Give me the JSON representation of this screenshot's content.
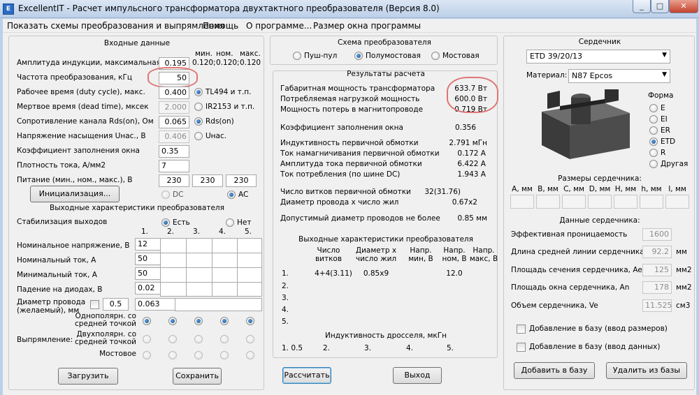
{
  "window": {
    "title": "ExcellentIT - Расчет импульсного трансформатора двухтактного преобразователя (Версия 8.0)",
    "icon": "app-icon"
  },
  "menu": [
    "Показать схемы преобразования и выпрямления",
    "Помощь",
    "О программе...",
    "Размер окна программы"
  ],
  "input": {
    "title": "Входные данные",
    "col_headers": [
      "мин.",
      "ном.",
      "макс."
    ],
    "amp_label": "Амплитуда индукции, максимальная, Т",
    "amp_value": "0.195",
    "amp_ref": [
      "0.120;",
      "0.120;",
      "0.120"
    ],
    "freq_label": "Частота преобразования, кГц",
    "freq_value": "50",
    "duty_label": "Рабочее время (duty cycle), макс.",
    "duty_value": "0.400",
    "duty_opt": "TL494 и т.п.",
    "dead_label": "Мертвое время (dead time), мксек",
    "dead_value": "2.000",
    "dead_opt": "IR2153 и т.п.",
    "rds_label": "Сопротивление канала Rds(on), Ом",
    "rds_value": "0.065",
    "rds_opt": "Rds(on)",
    "usat_label": "Напряжение насыщения Uнас., В",
    "usat_value": "0.406",
    "usat_opt": "Uнас.",
    "fill_label": "Коэффициент заполнения окна",
    "fill_value": "0.35",
    "dens_label": "Плотность тока, А/мм2",
    "dens_value": "7",
    "supply_label": "Питание (мин., ном., макс.), В",
    "supply": [
      "230",
      "230",
      "230"
    ],
    "init_button": "Инициализация...",
    "dc": "DC",
    "ac": "AC"
  },
  "output": {
    "title": "Выходные характеристики преобразователя",
    "stab_label": "Стабилизация выходов",
    "stab_yes": "Есть",
    "stab_no": "Нет",
    "cols": [
      "1.",
      "2.",
      "3.",
      "4.",
      "5."
    ],
    "rows": [
      {
        "label": "Номинальное напряжение, В",
        "value": "12"
      },
      {
        "label": "Номинальный ток, А",
        "value": "50"
      },
      {
        "label": "Минимальный ток, А",
        "value": "50"
      },
      {
        "label": "Падение на диодах, В",
        "value": "0.02"
      }
    ],
    "wire_label": "Диаметр провода\n(желаемый), мм",
    "wire_chk_value": "0.5",
    "wire_value": "0.063",
    "rect_label": "Выпрямление:",
    "rect_opts": [
      "Однополярн. со средней точкой",
      "Двухполярн. со средней точкой",
      "Мостовое"
    ]
  },
  "scheme": {
    "title": "Схема преобразователя",
    "opts": [
      "Пуш-пул",
      "Полумостовая",
      "Мостовая"
    ]
  },
  "results": {
    "title": "Результаты расчета",
    "rows": [
      {
        "label": "Габаритная мощность трансформатора",
        "value": "633.7 Вт"
      },
      {
        "label": "Потребляемая нагрузкой мощность",
        "value": "600.0 Вт"
      },
      {
        "label": "Мощность потерь в магнитопроводе",
        "value": "0.719 Вт"
      },
      {
        "label": "Коэффициент заполнения окна",
        "value": "0.356"
      },
      {
        "label": "Индуктивность первичной обмотки",
        "value": "2.791 мГн"
      },
      {
        "label": "Ток намагничивания первичной обмотки",
        "value": "0.172 А"
      },
      {
        "label": "Амплитуда тока первичной обмотки",
        "value": "6.422 А"
      },
      {
        "label": "Ток потребления (по шине DC)",
        "value": "1.943 А"
      },
      {
        "label": "Число витков первичной обмотки",
        "value": "32(31.76)"
      },
      {
        "label": "Диаметр провода x число жил",
        "value": "0.67x2"
      },
      {
        "label": "Допустимый диаметр проводов не более",
        "value": "0.85 мм"
      }
    ],
    "out_title": "Выходные характеристики преобразователя",
    "out_headers": [
      "Число\nвитков",
      "Диаметр x\nчисло жил",
      "Напр.\nмин, В",
      "Напр.\nном, В",
      "Напр.\nмакс, В"
    ],
    "out_rows": [
      {
        "n": "1.",
        "turns": "4+4(3.11)",
        "wire": "0.85x9",
        "vmin": "",
        "vnom": "12.0",
        "vmax": ""
      },
      {
        "n": "2.",
        "turns": "",
        "wire": "",
        "vmin": "",
        "vnom": "",
        "vmax": ""
      },
      {
        "n": "3.",
        "turns": "",
        "wire": "",
        "vmin": "",
        "vnom": "",
        "vmax": ""
      },
      {
        "n": "4.",
        "turns": "",
        "wire": "",
        "vmin": "",
        "vnom": "",
        "vmax": ""
      },
      {
        "n": "5.",
        "turns": "",
        "wire": "",
        "vmin": "",
        "vnom": "",
        "vmax": ""
      }
    ],
    "choke_title": "Индуктивность дросселя, мкГн",
    "choke": [
      "1. 0.5",
      "2.",
      "3.",
      "4.",
      "5."
    ]
  },
  "core": {
    "title": "Сердечник",
    "model": "ETD 39/20/13",
    "material_label": "Материал:",
    "material": "N87 Epcos",
    "shape_title": "Форма",
    "shapes": [
      "E",
      "EI",
      "ER",
      "ETD",
      "R",
      "Другая"
    ],
    "dims_title": "Размеры сердечника:",
    "dims": [
      "A, мм",
      "B, мм",
      "C, мм",
      "D, мм",
      "H, мм",
      "h, мм",
      "I, мм"
    ],
    "data_title": "Данные сердечника:",
    "data": [
      {
        "label": "Эффективная проницаемость",
        "value": "1600",
        "unit": ""
      },
      {
        "label": "Длина средней линии сердечника, le",
        "value": "92.2",
        "unit": "мм"
      },
      {
        "label": "Площадь сечения сердечника, Ae",
        "value": "125",
        "unit": "мм2"
      },
      {
        "label": "Площадь окна сердечника, An",
        "value": "178",
        "unit": "мм2"
      },
      {
        "label": "Объем сердечника, Ve",
        "value": "11.525",
        "unit": "см3"
      }
    ],
    "add_dims": "Добавление в базу (ввод размеров)",
    "add_data": "Добавление в базу (ввод данных)",
    "add_btn": "Добавить в базу",
    "del_btn": "Удалить из базы"
  },
  "buttons": {
    "load": "Загрузить",
    "save": "Сохранить",
    "calc": "Рассчитать",
    "exit": "Выход"
  },
  "colors": {
    "annotation": "#e07575",
    "accent": "#1a4e8c"
  }
}
